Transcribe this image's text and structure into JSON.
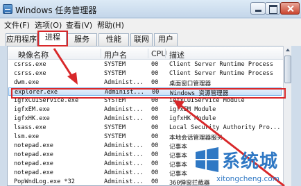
{
  "window": {
    "title": "Windows 任务管理器"
  },
  "menu": [
    "文件(F)",
    "选项(O)",
    "查看(V)",
    "帮助(H)"
  ],
  "tabs": [
    "应用程序",
    "进程",
    "服务",
    "性能",
    "联网",
    "用户"
  ],
  "selected_tab": "进程",
  "columns": [
    "映像名称",
    "用户名",
    "CPU",
    "描述"
  ],
  "rows": [
    {
      "name": "csrss.exe",
      "user": "SYSTEM",
      "cpu": "00",
      "desc": "Client Server Runtime Process"
    },
    {
      "name": "csrss.exe",
      "user": "SYSTEM",
      "cpu": "00",
      "desc": "Client Server Runtime Process"
    },
    {
      "name": "dwm.exe",
      "user": "Administ...",
      "cpu": "00",
      "desc": "桌面窗口管理器"
    },
    {
      "name": "explorer.exe",
      "user": "Administ...",
      "cpu": "00",
      "desc": "Windows 资源管理器"
    },
    {
      "name": "igfxCUIService.exe",
      "user": "SYSTEM",
      "cpu": "00",
      "desc": "igfxCUIService Module"
    },
    {
      "name": "igfxEM.exe",
      "user": "Administ...",
      "cpu": "00",
      "desc": "igfxEM Module"
    },
    {
      "name": "igfxHK.exe",
      "user": "Administ...",
      "cpu": "00",
      "desc": "igfxHK Module"
    },
    {
      "name": "lsass.exe",
      "user": "SYSTEM",
      "cpu": "00",
      "desc": "Local Security Authority Pro..."
    },
    {
      "name": "lsm.exe",
      "user": "SYSTEM",
      "cpu": "00",
      "desc": "本地会话管理器服务"
    },
    {
      "name": "notepad.exe",
      "user": "Administ...",
      "cpu": "00",
      "desc": "记事本"
    },
    {
      "name": "notepad.exe",
      "user": "Administ...",
      "cpu": "00",
      "desc": "记事本"
    },
    {
      "name": "notepad.exe",
      "user": "Administ...",
      "cpu": "00",
      "desc": "记事本"
    },
    {
      "name": "notepad.exe",
      "user": "Administ...",
      "cpu": "00",
      "desc": "记事本"
    },
    {
      "name": "PopWndLog.exe *32",
      "user": "Administ...",
      "cpu": "00",
      "desc": "360弹窗拦截器"
    }
  ],
  "selected_row": 3,
  "annotation_color": "#d8282a",
  "watermark": {
    "brand": "系统城",
    "url": "xitongcheng.com",
    "color": "#2f78c4"
  }
}
